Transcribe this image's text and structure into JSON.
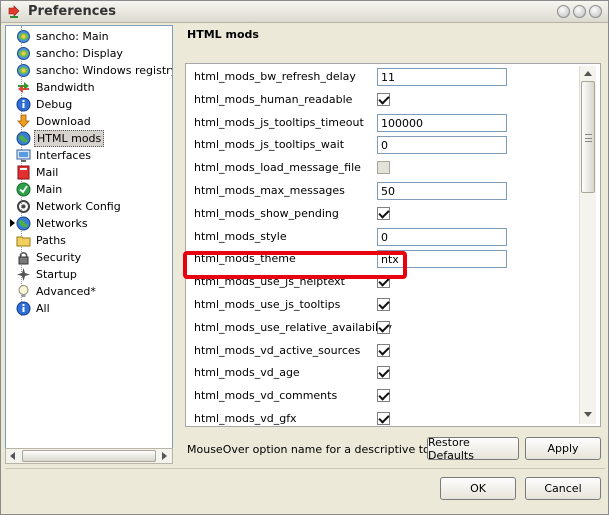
{
  "window": {
    "title": "Preferences"
  },
  "tree": {
    "items": [
      {
        "label": "sancho: Main",
        "icon": "gear-icon"
      },
      {
        "label": "sancho: Display",
        "icon": "gear-icon"
      },
      {
        "label": "sancho: Windows registry",
        "icon": "gear-icon"
      },
      {
        "label": "Bandwidth",
        "icon": "arrows-icon"
      },
      {
        "label": "Debug",
        "icon": "info-icon"
      },
      {
        "label": "Download",
        "icon": "download-icon"
      },
      {
        "label": "HTML mods",
        "icon": "globe-icon",
        "selected": true
      },
      {
        "label": "Interfaces",
        "icon": "interfaces-icon"
      },
      {
        "label": "Mail",
        "icon": "mail-icon"
      },
      {
        "label": "Main",
        "icon": "main-icon"
      },
      {
        "label": "Network Config",
        "icon": "network-config-icon"
      },
      {
        "label": "Networks",
        "icon": "globe-icon",
        "expandable": true
      },
      {
        "label": "Paths",
        "icon": "paths-icon"
      },
      {
        "label": "Security",
        "icon": "lock-icon"
      },
      {
        "label": "Startup",
        "icon": "startup-icon"
      },
      {
        "label": "Advanced*",
        "icon": "bulb-icon"
      },
      {
        "label": "All",
        "icon": "info-icon"
      }
    ]
  },
  "section": {
    "title": "HTML mods"
  },
  "properties": [
    {
      "name": "html_mods_bw_refresh_delay",
      "type": "text",
      "value": "11"
    },
    {
      "name": "html_mods_human_readable",
      "type": "check",
      "checked": true
    },
    {
      "name": "html_mods_js_tooltips_timeout",
      "type": "text",
      "value": "100000"
    },
    {
      "name": "html_mods_js_tooltips_wait",
      "type": "text",
      "value": "0"
    },
    {
      "name": "html_mods_load_message_file",
      "type": "check",
      "checked": false
    },
    {
      "name": "html_mods_max_messages",
      "type": "text",
      "value": "50"
    },
    {
      "name": "html_mods_show_pending",
      "type": "check",
      "checked": true
    },
    {
      "name": "html_mods_style",
      "type": "text",
      "value": "0"
    },
    {
      "name": "html_mods_theme",
      "type": "text",
      "value": "ntx"
    },
    {
      "name": "html_mods_use_js_helptext",
      "type": "check",
      "checked": true
    },
    {
      "name": "html_mods_use_js_tooltips",
      "type": "check",
      "checked": true
    },
    {
      "name": "html_mods_use_relative_availability",
      "type": "check",
      "checked": true
    },
    {
      "name": "html_mods_vd_active_sources",
      "type": "check",
      "checked": true
    },
    {
      "name": "html_mods_vd_age",
      "type": "check",
      "checked": true
    },
    {
      "name": "html_mods_vd_comments",
      "type": "check",
      "checked": true
    },
    {
      "name": "html_mods_vd_gfx",
      "type": "check",
      "checked": true
    }
  ],
  "footer": {
    "hint": "MouseOver option name for a descriptive tooltip!",
    "restore_label": "Restore Defaults",
    "apply_label": "Apply",
    "ok_label": "OK",
    "cancel_label": "Cancel"
  },
  "colors": {
    "highlight": "#e8000f",
    "selection": "#d6d3ce"
  }
}
